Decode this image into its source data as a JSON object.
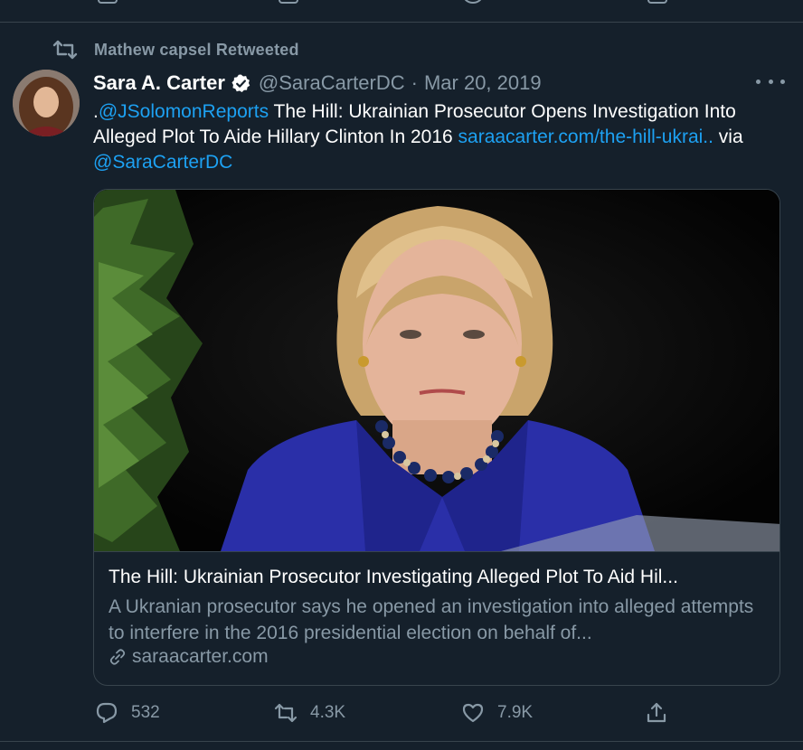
{
  "retweet": {
    "text": "Mathew capsel Retweeted"
  },
  "tweet": {
    "author_name": "Sara A. Carter",
    "handle": "@SaraCarterDC",
    "separator": "·",
    "date": "Mar 20, 2019",
    "text_prefix": ".",
    "mention": "@JSolomonReports",
    "text_body": " The Hill: Ukrainian Prosecutor Opens Investigation Into Alleged Plot To Aide Hillary Clinton In 2016 ",
    "url": "saraacarter.com/the-hill-ukrai..",
    "via_text": " via ",
    "via_mention": "@SaraCarterDC"
  },
  "card": {
    "title": "The Hill: Ukrainian Prosecutor Investigating Alleged Plot To Aid Hil...",
    "description": "A Ukranian prosecutor says he opened an investigation into alleged attempts to interfere in the 2016 presidential election on behalf of...",
    "domain": "saraacarter.com"
  },
  "actions": {
    "reply_count": "532",
    "retweet_count": "4.3K",
    "like_count": "7.9K"
  },
  "colors": {
    "background": "#15202b",
    "accent": "#1da1f2",
    "secondary_text": "#8899a6",
    "border": "#38444d"
  },
  "icons": [
    "retweet-icon",
    "verified-badge-icon",
    "more-options-icon",
    "link-icon",
    "reply-icon",
    "retweet-icon",
    "like-icon",
    "share-icon"
  ]
}
